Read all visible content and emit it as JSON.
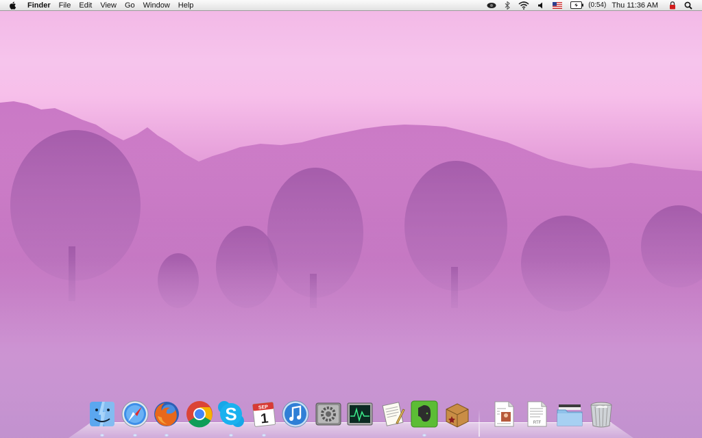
{
  "menubar": {
    "app_name": "Finder",
    "menus": [
      "File",
      "Edit",
      "View",
      "Go",
      "Window",
      "Help"
    ],
    "battery_time": "(0:54)",
    "clock": "Thu 11:36 AM",
    "status_icons": [
      "eye-icon",
      "bluetooth-icon",
      "wifi-icon",
      "volume-icon",
      "us-flag-icon",
      "battery-icon",
      "lock-icon",
      "spotlight-icon"
    ]
  },
  "calendar_icon": {
    "month": "SEP",
    "day": "1"
  },
  "rtf_doc": {
    "label": "RTF"
  },
  "dock": {
    "apps": [
      "finder-icon",
      "safari-icon",
      "firefox-icon",
      "chrome-icon",
      "skype-icon",
      "ical-icon",
      "itunes-icon",
      "system-preferences-icon",
      "activity-monitor-icon",
      "preview-icon",
      "evernote-icon",
      "delicious-library-icon"
    ],
    "docs": [
      "document-icon",
      "rtf-document-icon",
      "downloads-folder-icon",
      "trash-icon"
    ]
  },
  "colors": {
    "sky_top": "#f2b7e6",
    "fog_mid": "#cf84c8",
    "ground": "#b98ac9",
    "menubar": "#ececec"
  }
}
